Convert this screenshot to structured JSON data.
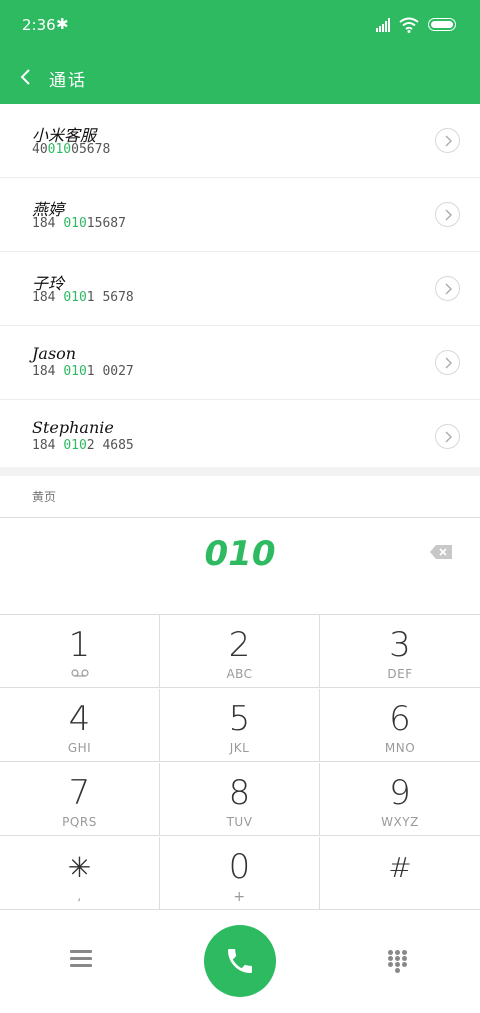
{
  "status_bar": {
    "time": "2:36",
    "bluetooth_glyph": "✱"
  },
  "header": {
    "title": "通话"
  },
  "results": [
    {
      "name": "小米客服",
      "number_pre": "40",
      "number_match": "010",
      "number_post": "05678"
    },
    {
      "name": "燕婷",
      "number_pre": "184 ",
      "number_match": "010",
      "number_post": "15687"
    },
    {
      "name": "子玲",
      "number_pre": "184 ",
      "number_match": "010",
      "number_post": "1 5678"
    },
    {
      "name": "Jason",
      "number_pre": "184 ",
      "number_match": "010",
      "number_post": "1 0027"
    },
    {
      "name": "Stephanie",
      "number_pre": "184 ",
      "number_match": "010",
      "number_post": "2 4685"
    }
  ],
  "section_label": "黄页",
  "dialer": {
    "digits": "010"
  },
  "keypad": [
    {
      "digit": "1",
      "letters": ""
    },
    {
      "digit": "2",
      "letters": "ABC"
    },
    {
      "digit": "3",
      "letters": "DEF"
    },
    {
      "digit": "4",
      "letters": "GHI"
    },
    {
      "digit": "5",
      "letters": "JKL"
    },
    {
      "digit": "6",
      "letters": "MNO"
    },
    {
      "digit": "7",
      "letters": "PQRS"
    },
    {
      "digit": "8",
      "letters": "TUV"
    },
    {
      "digit": "9",
      "letters": "WXYZ"
    },
    {
      "digit": "✳",
      "letters": ","
    },
    {
      "digit": "0",
      "letters": "+"
    },
    {
      "digit": "#",
      "letters": ""
    }
  ],
  "colors": {
    "accent": "#2dba61",
    "divider": "#dddddd",
    "text": "#333333"
  },
  "icons": {
    "back": "chevron-left-icon",
    "detail": "chevron-right-circle-icon",
    "delete": "backspace-icon",
    "menu": "menu-icon",
    "call": "phone-icon",
    "keypad": "dialpad-icon",
    "voicemail": "voicemail-icon"
  }
}
